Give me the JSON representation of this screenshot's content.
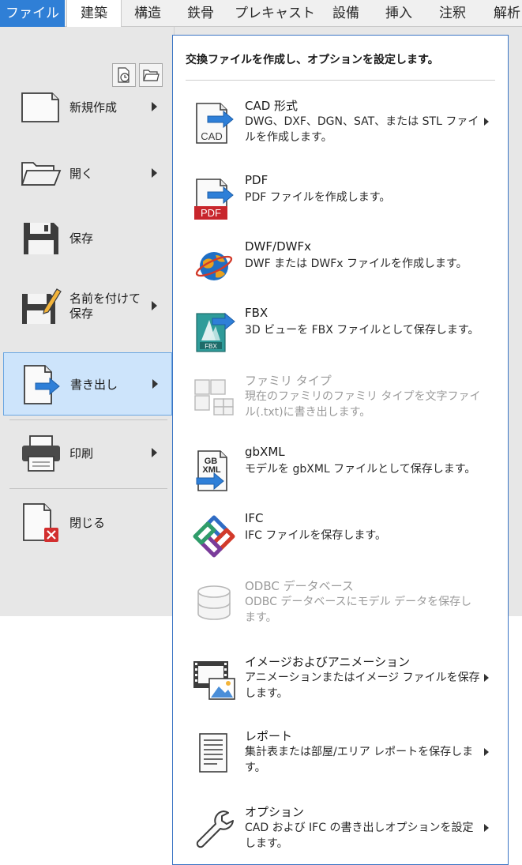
{
  "ribbon": {
    "tabs": [
      "ファイル",
      "建築",
      "構造",
      "鉄骨",
      "プレキャスト",
      "設備",
      "挿入",
      "注釈",
      "解析"
    ]
  },
  "app_menu": {
    "items": [
      {
        "label": "新規作成",
        "icon": "new-document-icon",
        "has_submenu": true
      },
      {
        "label": "開く",
        "icon": "open-folder-icon",
        "has_submenu": true
      },
      {
        "label": "保存",
        "icon": "save-disk-icon",
        "has_submenu": false
      },
      {
        "label": "名前を付けて保存",
        "icon": "save-as-icon",
        "has_submenu": true
      },
      {
        "label": "書き出し",
        "icon": "export-icon",
        "has_submenu": true,
        "active": true
      },
      {
        "label": "印刷",
        "icon": "printer-icon",
        "has_submenu": true
      },
      {
        "label": "閉じる",
        "icon": "close-document-icon",
        "has_submenu": false
      }
    ],
    "quick_buttons": [
      "recent-documents-icon",
      "open-documents-icon"
    ]
  },
  "export_menu": {
    "header": "交換ファイルを作成し、オプションを設定します。",
    "items": [
      {
        "title": "CAD 形式",
        "desc": "DWG、DXF、DGN、SAT、または STL ファイルを作成します。",
        "icon": "cad-export-icon",
        "has_submenu": true,
        "enabled": true
      },
      {
        "title": "PDF",
        "desc": "PDF ファイルを作成します。",
        "icon": "pdf-export-icon",
        "has_submenu": false,
        "enabled": true
      },
      {
        "title": "DWF/DWFx",
        "desc": "DWF または DWFx ファイルを作成します。",
        "icon": "dwf-globe-icon",
        "has_submenu": false,
        "enabled": true
      },
      {
        "title": "FBX",
        "desc": "3D ビューを FBX ファイルとして保存します。",
        "icon": "fbx-export-icon",
        "has_submenu": false,
        "enabled": true
      },
      {
        "title": "ファミリ タイプ",
        "desc": "現在のファミリのファミリ タイプを文字ファイル(.txt)に書き出します。",
        "icon": "family-types-icon",
        "has_submenu": false,
        "enabled": false
      },
      {
        "title": "gbXML",
        "desc": "モデルを gbXML ファイルとして保存します。",
        "icon": "gbxml-export-icon",
        "has_submenu": false,
        "enabled": true
      },
      {
        "title": "IFC",
        "desc": "IFC ファイルを保存します。",
        "icon": "ifc-logo-icon",
        "has_submenu": false,
        "enabled": true
      },
      {
        "title": "ODBC データベース",
        "desc": "ODBC データベースにモデル データを保存します。",
        "icon": "database-icon",
        "has_submenu": false,
        "enabled": false
      },
      {
        "title": "イメージおよびアニメーション",
        "desc": "アニメーションまたはイメージ ファイルを保存します。",
        "icon": "film-image-icon",
        "has_submenu": true,
        "enabled": true
      },
      {
        "title": "レポート",
        "desc": "集計表または部屋/エリア レポートを保存します。",
        "icon": "report-icon",
        "has_submenu": true,
        "enabled": true
      },
      {
        "title": "オプション",
        "desc": "CAD および IFC の書き出しオプションを設定します。",
        "icon": "wrench-icon",
        "has_submenu": true,
        "enabled": true
      }
    ]
  },
  "colors": {
    "file_tab": "#2f7fd6",
    "active_item": "#cde4fb",
    "export_arrow": "#2e7fd8",
    "pdf_red": "#c8262c"
  }
}
